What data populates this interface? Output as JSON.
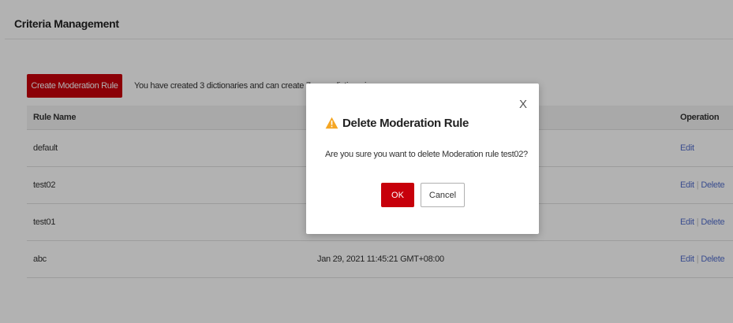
{
  "header": {
    "title": "Criteria Management"
  },
  "toolbar": {
    "create_label": "Create Moderation Rule",
    "info": "You have created 3 dictionaries and can create 7 more dictionaries."
  },
  "table": {
    "headers": {
      "name": "Rule Name",
      "time": "",
      "operation": "Operation"
    },
    "rows": [
      {
        "name": "default",
        "time": "",
        "edit": "Edit",
        "delete": ""
      },
      {
        "name": "test02",
        "time": "",
        "edit": "Edit",
        "delete": "Delete"
      },
      {
        "name": "test01",
        "time": "",
        "edit": "Edit",
        "delete": "Delete"
      },
      {
        "name": "abc",
        "time": "Jan 29, 2021 11:45:21 GMT+08:00",
        "edit": "Edit",
        "delete": "Delete"
      }
    ]
  },
  "dialog": {
    "title": "Delete Moderation Rule",
    "message": "Are you sure you want to delete Moderation rule test02?",
    "ok_label": "OK",
    "cancel_label": "Cancel",
    "close_glyph": "X",
    "icon": "warning-icon"
  },
  "colors": {
    "primary": "#c7000b",
    "link": "#526ecc",
    "warning": "#f5a623"
  }
}
